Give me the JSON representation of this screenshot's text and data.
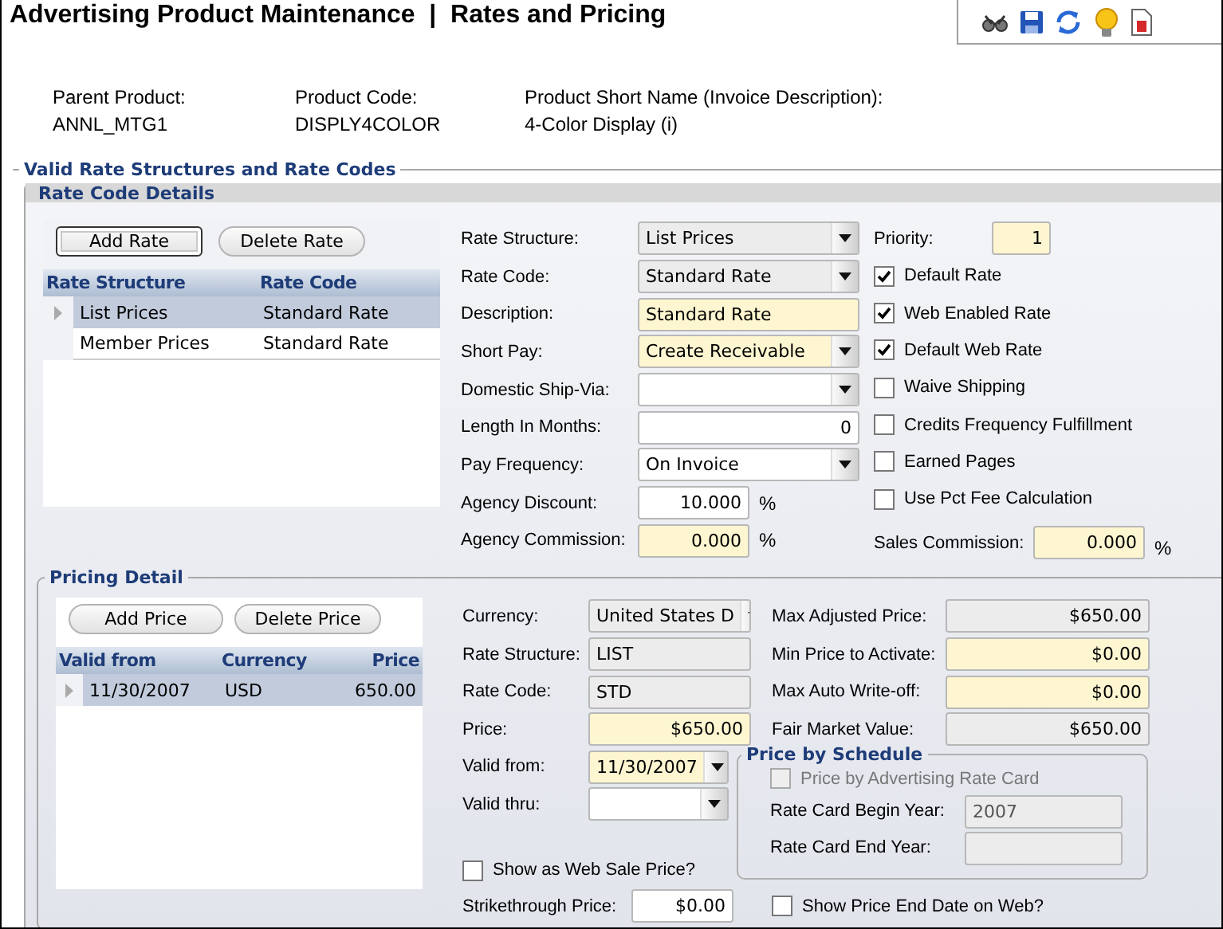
{
  "title": "Advertising Product Maintenance  |  Rates and Pricing",
  "toolbar": [
    {
      "kind": "glasses"
    },
    {
      "kind": "save"
    },
    {
      "kind": "refresh"
    },
    {
      "kind": "bulb"
    },
    {
      "kind": "report"
    }
  ],
  "product": [
    {
      "label": "Parent Product:",
      "value": "ANNL_MTG1"
    },
    {
      "label": "Product Code:",
      "value": "DISPLY4COLOR"
    },
    {
      "label": "Product Short Name (Invoice Description):",
      "value": "4-Color Display (i)"
    }
  ],
  "rates_section": {
    "title": "Valid Rate Structures and Rate Codes",
    "rate_code_details": {
      "title": "Rate Code Details",
      "buttons": [
        {
          "label": "Add Rate",
          "focused": true
        },
        {
          "label": "Delete Rate",
          "focused": false
        }
      ],
      "grid": {
        "columns": [
          "Rate Structure",
          "Rate Code"
        ],
        "rows": [
          {
            "cells": [
              "List Prices",
              "Standard Rate"
            ],
            "selected": true
          },
          {
            "cells": [
              "Member Prices",
              "Standard Rate"
            ],
            "selected": false
          }
        ]
      },
      "fields": [
        {
          "label": "Rate Structure:",
          "kind": "select",
          "value": "List Prices",
          "required": false,
          "readonly": true
        },
        {
          "label": "Rate Code:",
          "kind": "select",
          "value": "Standard Rate",
          "required": false,
          "readonly": true
        },
        {
          "label": "Description:",
          "kind": "text",
          "value": "Standard Rate",
          "required": true,
          "readonly": false
        },
        {
          "label": "Short Pay:",
          "kind": "select",
          "value": "Create Receivable",
          "required": true,
          "readonly": false
        },
        {
          "label": "Domestic Ship-Via:",
          "kind": "select",
          "required": false,
          "readonly": false
        },
        {
          "label": "Length In Months:",
          "kind": "number",
          "value": "0",
          "required": false,
          "readonly": false
        },
        {
          "label": "Pay Frequency:",
          "kind": "select",
          "value": "On Invoice",
          "required": false,
          "readonly": false
        },
        {
          "label": "Agency Discount:",
          "kind": "number",
          "value": "10.000",
          "required": false,
          "readonly": false,
          "unit": "%"
        },
        {
          "label": "Agency Commission:",
          "kind": "number",
          "value": "0.000",
          "required": true,
          "readonly": false,
          "unit": "%"
        }
      ],
      "priority": {
        "label": "Priority:",
        "value": "1"
      },
      "options": [
        {
          "label": "Default Rate",
          "checked": true
        },
        {
          "label": "Web Enabled Rate",
          "checked": true
        },
        {
          "label": "Default Web Rate",
          "checked": true
        },
        {
          "label": "Waive Shipping",
          "checked": false
        },
        {
          "label": "Credits Frequency Fulfillment",
          "checked": false
        },
        {
          "label": "Earned Pages",
          "checked": false
        },
        {
          "label": "Use Pct Fee Calculation",
          "checked": false
        }
      ],
      "sales_commission": {
        "label": "Sales Commission:",
        "value": "0.000",
        "unit": "%"
      }
    },
    "pricing_detail": {
      "title": "Pricing Detail",
      "buttons": [
        {
          "label": "Add Price",
          "focused": false
        },
        {
          "label": "Delete Price",
          "focused": false
        }
      ],
      "grid": {
        "columns": [
          "Valid from",
          "Currency",
          "Price"
        ],
        "rows": [
          {
            "cells": [
              "11/30/2007",
              "USD",
              "650.00"
            ],
            "selected": true
          }
        ]
      },
      "fields": [
        {
          "label": "Currency:",
          "kind": "select",
          "value": "United States D",
          "required": false,
          "readonly": true
        },
        {
          "label": "Rate Structure:",
          "kind": "text",
          "value": "LIST",
          "required": false,
          "readonly": true
        },
        {
          "label": "Rate Code:",
          "kind": "text",
          "value": "STD",
          "required": false,
          "readonly": true
        },
        {
          "label": "Price:",
          "kind": "number",
          "value": "$650.00",
          "required": true,
          "readonly": false
        },
        {
          "label": "Valid from:",
          "kind": "date",
          "value": "11/30/2007",
          "required": true,
          "readonly": false
        },
        {
          "label": "Valid thru:",
          "kind": "date",
          "required": false,
          "readonly": false
        }
      ],
      "limits": [
        {
          "label": "Max Adjusted Price:",
          "kind": "number",
          "value": "$650.00",
          "required": false,
          "readonly": true
        },
        {
          "label": "Min Price to Activate:",
          "kind": "number",
          "value": "$0.00",
          "required": true,
          "readonly": false
        },
        {
          "label": "Max Auto Write-off:",
          "kind": "number",
          "value": "$0.00",
          "required": true,
          "readonly": false
        },
        {
          "label": "Fair Market Value:",
          "kind": "number",
          "value": "$650.00",
          "required": false,
          "readonly": true
        }
      ],
      "schedule": {
        "title": "Price by Schedule",
        "option": {
          "label": "Price by Advertising Rate Card",
          "checked": false,
          "disabled": true
        },
        "fields": [
          {
            "label": "Rate Card Begin Year:",
            "kind": "text",
            "value": "2007",
            "required": false,
            "readonly": true
          },
          {
            "label": "Rate Card End Year:",
            "kind": "text",
            "required": false,
            "readonly": true
          }
        ]
      },
      "web_sale": {
        "label": "Show as Web Sale Price?",
        "checked": false
      },
      "strikethrough": {
        "label": "Strikethrough Price:",
        "kind": "number",
        "value": "$0.00",
        "required": false,
        "readonly": false
      },
      "end_date": {
        "label": "Show Price End Date on Web?",
        "checked": false
      }
    }
  }
}
